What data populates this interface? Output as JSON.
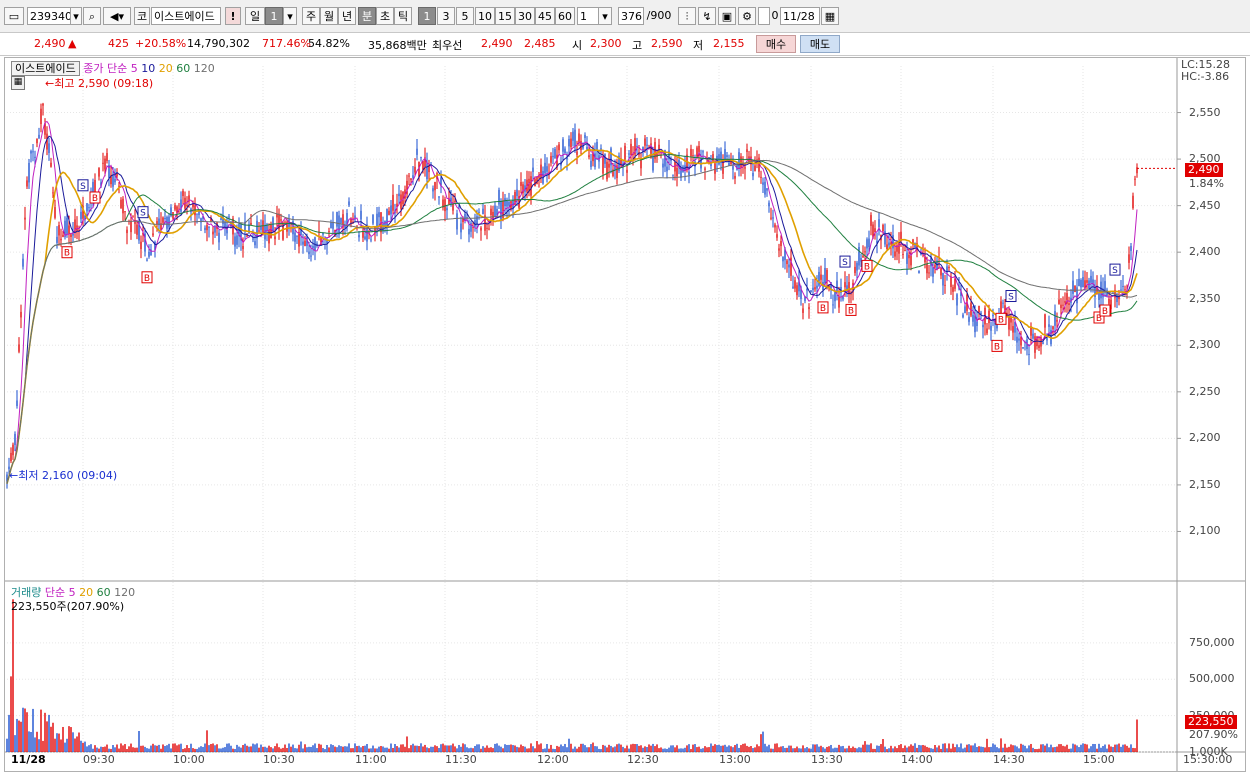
{
  "toolbar": {
    "code": "239340",
    "market_tag": "코",
    "stock_name": "이스트에이드",
    "exclaim": "!",
    "period_day": "일",
    "period_count": "1",
    "period_buttons": [
      "주",
      "월",
      "년",
      "분",
      "초",
      "틱"
    ],
    "period_selected": "분",
    "interval_buttons": [
      "1",
      "3",
      "5",
      "10",
      "15",
      "30",
      "45",
      "60"
    ],
    "interval_selected": "1",
    "interval_input": "1",
    "bar_count": "376",
    "bar_total": "/900",
    "checkbox_label": "0",
    "date": "11/28"
  },
  "quote": {
    "price": "2,490",
    "arrow": "▲",
    "change": "425",
    "change_pct": "+20.58%",
    "volume": "14,790,302",
    "volume_ratio": "717.46%",
    "turnover": "54.82%",
    "amount": "35,868백만",
    "best_ask_label": "최우선",
    "best_ask": "2,490",
    "best_bid": "2,485",
    "open_label": "시",
    "open": "2,300",
    "high_label": "고",
    "high": "2,590",
    "low_label": "저",
    "low": "2,155",
    "buy_label": "매수",
    "sell_label": "매도"
  },
  "price_panel": {
    "stock_name": "이스트에이드",
    "ma_label": "종가 단순",
    "ma_periods": [
      "5",
      "10",
      "20",
      "60",
      "120"
    ],
    "high_note": "최고 2,590 (09:18)",
    "low_note": "최저 2,160 (09:04)",
    "lc": "LC:15.28",
    "hc": "HC:-3.86",
    "current_price": "2,490",
    "current_pct": "1.84%"
  },
  "volume_panel": {
    "label": "거래량",
    "ma_label": "단순",
    "ma_periods": [
      "5",
      "20",
      "60",
      "120"
    ],
    "last_volume_note": "223,550주(207.90%)",
    "current_volume": "223,550",
    "current_pct": "207.90%"
  },
  "colors": {
    "up": "#e00000",
    "down": "#1a4fd0",
    "ma5": "#c020c0",
    "ma10": "#1a1a9a",
    "ma20": "#e0a000",
    "ma60": "#208040",
    "ma120": "#707070"
  },
  "chart_data": {
    "type": "candlestick",
    "y_axis_ticks": [
      "2,550",
      "2,500",
      "2,450",
      "2,400",
      "2,350",
      "2,300",
      "2,250",
      "2,200",
      "2,150",
      "2,100"
    ],
    "volume_axis_ticks": [
      "1,000K",
      "750,000",
      "500,000",
      "250,000"
    ],
    "x_axis_ticks": [
      "11/28",
      "09:30",
      "10:00",
      "10:30",
      "11:00",
      "11:30",
      "12:00",
      "12:30",
      "13:00",
      "13:30",
      "14:00",
      "14:30",
      "15:00",
      "15:30:00"
    ],
    "ylim": [
      2050,
      2600
    ],
    "series_close": [
      [
        0,
        2160
      ],
      [
        4,
        2200
      ],
      [
        10,
        2480
      ],
      [
        18,
        2560
      ],
      [
        25,
        2420
      ],
      [
        35,
        2430
      ],
      [
        40,
        2450
      ],
      [
        50,
        2500
      ],
      [
        60,
        2440
      ],
      [
        70,
        2400
      ],
      [
        80,
        2440
      ],
      [
        90,
        2450
      ],
      [
        100,
        2430
      ],
      [
        120,
        2420
      ],
      [
        140,
        2430
      ],
      [
        150,
        2410
      ],
      [
        160,
        2420
      ],
      [
        170,
        2440
      ],
      [
        180,
        2420
      ],
      [
        195,
        2450
      ],
      [
        205,
        2500
      ],
      [
        215,
        2470
      ],
      [
        225,
        2440
      ],
      [
        235,
        2430
      ],
      [
        245,
        2450
      ],
      [
        255,
        2460
      ],
      [
        265,
        2480
      ],
      [
        275,
        2500
      ],
      [
        285,
        2520
      ],
      [
        295,
        2500
      ],
      [
        305,
        2490
      ],
      [
        315,
        2510
      ],
      [
        325,
        2500
      ],
      [
        335,
        2490
      ],
      [
        345,
        2500
      ],
      [
        355,
        2500
      ],
      [
        365,
        2490
      ],
      [
        375,
        2500
      ],
      [
        385,
        2420
      ],
      [
        392,
        2380
      ],
      [
        398,
        2345
      ],
      [
        404,
        2360
      ],
      [
        410,
        2370
      ],
      [
        418,
        2350
      ],
      [
        425,
        2380
      ],
      [
        432,
        2430
      ],
      [
        440,
        2410
      ],
      [
        450,
        2400
      ],
      [
        460,
        2390
      ],
      [
        470,
        2380
      ],
      [
        478,
        2340
      ],
      [
        485,
        2330
      ],
      [
        492,
        2320
      ],
      [
        500,
        2340
      ],
      [
        507,
        2300
      ],
      [
        515,
        2310
      ],
      [
        522,
        2320
      ],
      [
        530,
        2350
      ],
      [
        538,
        2370
      ],
      [
        546,
        2360
      ],
      [
        553,
        2350
      ],
      [
        560,
        2370
      ],
      [
        565,
        2490
      ]
    ]
  }
}
